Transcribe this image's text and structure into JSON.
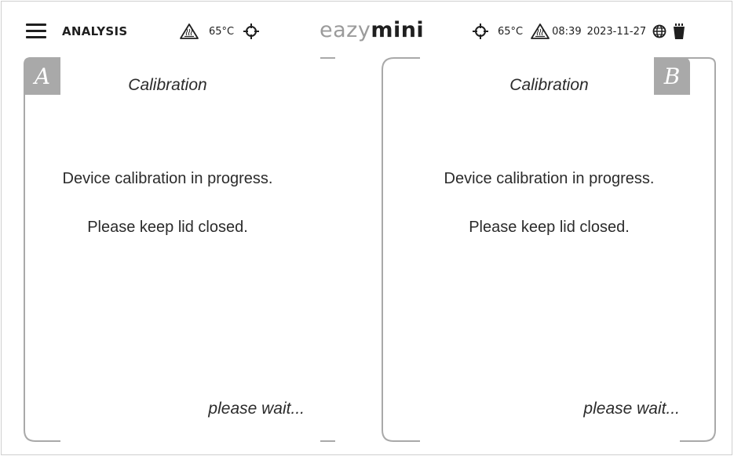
{
  "header": {
    "screen_title": "ANALYSIS",
    "logo_part1": "eazy",
    "logo_part2": "mini",
    "left_status": {
      "heater_icon": "heater-warning-icon",
      "temperature": "65°C",
      "target_icon": "crosshair-target-icon"
    },
    "right_status": {
      "target_icon": "crosshair-target-icon",
      "temperature": "65°C",
      "heater_icon": "heater-warning-icon",
      "time": "08:39",
      "date": "2023-11-27",
      "globe_icon": "globe-icon",
      "bin_icon": "waste-bin-icon"
    }
  },
  "panels": [
    {
      "tab_label": "A",
      "title": "Calibration",
      "message_line1": "Device calibration in progress.",
      "message_line2": "Please keep lid closed.",
      "footer": "please wait..."
    },
    {
      "tab_label": "B",
      "title": "Calibration",
      "message_line1": "Device calibration in progress.",
      "message_line2": "Please keep lid closed.",
      "footer": "please wait..."
    }
  ],
  "colors": {
    "frame": "#a9a9a9",
    "tab": "#a9a9a9",
    "text": "#2b2b2b",
    "logo_light": "#9b9b9b",
    "logo_dark": "#1f1f1f"
  }
}
